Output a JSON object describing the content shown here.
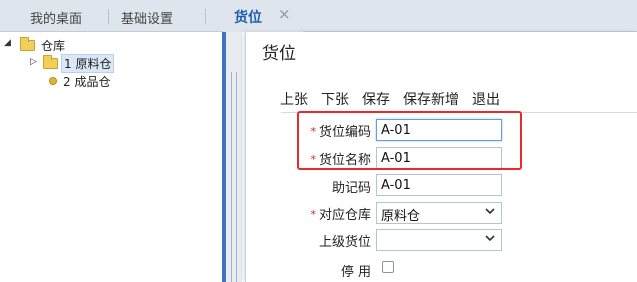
{
  "tabs": {
    "desktop": "我的桌面",
    "basic": "基础设置",
    "active": "货位",
    "close_icon": "×"
  },
  "tree": {
    "root": "仓库",
    "items": [
      {
        "label": "1 原料仓"
      },
      {
        "label": "2 成品仓"
      }
    ]
  },
  "dialog": {
    "title": "货位",
    "toolbar": [
      "上张",
      "下张",
      "保存",
      "保存新增",
      "退出"
    ],
    "fields": {
      "code": {
        "label": "货位编码",
        "value": "A-01",
        "required": "*"
      },
      "name": {
        "label": "货位名称",
        "value": "A-01",
        "required": "*"
      },
      "mnemonic": {
        "label": "助记码",
        "value": "A-01"
      },
      "warehouse": {
        "label": "对应仓库",
        "value": "原料仓",
        "required": "*"
      },
      "parent": {
        "label": "上级货位",
        "value": ""
      },
      "disabled": {
        "label": "停 用",
        "checked": false
      }
    }
  },
  "colors": {
    "accent": "#1e5fae",
    "highlight_box": "#e52b2b",
    "required": "#e02020"
  }
}
